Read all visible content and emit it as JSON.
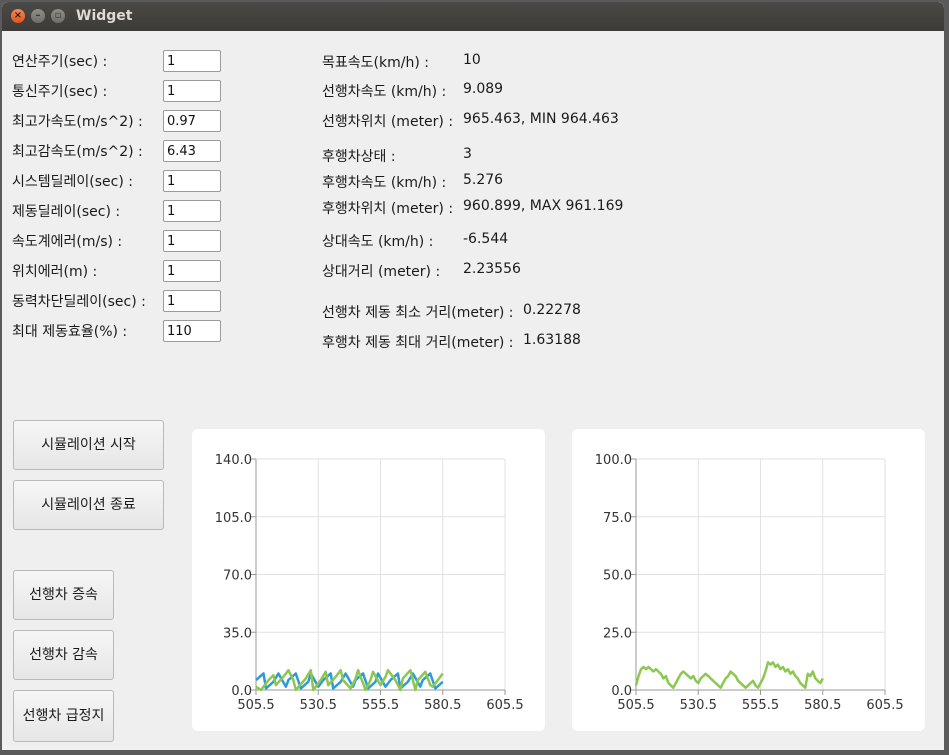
{
  "window": {
    "title": "Widget"
  },
  "params": [
    {
      "label": "연산주기(sec) :",
      "value": "1"
    },
    {
      "label": "통신주기(sec) :",
      "value": "1"
    },
    {
      "label": "최고가속도(m/s^2) :",
      "value": "0.97"
    },
    {
      "label": "최고감속도(m/s^2) :",
      "value": "6.43"
    },
    {
      "label": "시스템딜레이(sec) :",
      "value": "1"
    },
    {
      "label": "제동딜레이(sec) :",
      "value": "1"
    },
    {
      "label": "속도계에러(m/s) :",
      "value": "1"
    },
    {
      "label": "위치에러(m) :",
      "value": "1"
    },
    {
      "label": "동력차단딜레이(sec) :",
      "value": "1"
    },
    {
      "label": "최대 제동효율(%) :",
      "value": "110"
    }
  ],
  "status": [
    {
      "label": "목표속도(km/h) :",
      "value": "10"
    },
    {
      "label": "선행차속도 (km/h) :",
      "value": "9.089"
    },
    {
      "label": "선행차위치 (meter) :",
      "value": "965.463, MIN 964.463"
    },
    {
      "label": "후행차상태 :",
      "value": "3"
    },
    {
      "label": "후행차속도 (km/h) :",
      "value": "5.276"
    },
    {
      "label": "후행차위치 (meter) :",
      "value": "960.899, MAX 961.169"
    },
    {
      "label": "상대속도 (km/h) :",
      "value": "-6.544"
    },
    {
      "label": "상대거리 (meter) :",
      "value": "2.23556"
    },
    {
      "label": "선행차 제동 최소 거리(meter) :",
      "value": "0.22278"
    },
    {
      "label": "후행차 제동 최대 거리(meter) :",
      "value": "1.63188"
    }
  ],
  "buttons": {
    "sim_start": "시뮬레이션 시작",
    "sim_stop": "시뮬레이션 종료",
    "lead_accel": "선행차 증속",
    "lead_decel": "선행차 감속",
    "lead_emergency_stop": "선행차 급정지"
  },
  "colors": {
    "series_blue": "#2f9ad8",
    "series_green": "#8cc84f"
  },
  "chart_data": [
    {
      "type": "line",
      "title": "",
      "xlabel": "",
      "ylabel": "",
      "xlim": [
        505.5,
        605.5
      ],
      "ylim": [
        0,
        140
      ],
      "xticks": [
        "505.5",
        "530.5",
        "555.5",
        "580.5",
        "605.5"
      ],
      "yticks": [
        "140.0",
        "105.0",
        "70.0",
        "35.0",
        "0.0"
      ],
      "grid": true,
      "series": [
        {
          "color": "#2f9ad8",
          "x": [
            505.5,
            508.5,
            509.5,
            512.5,
            514.5,
            517.5,
            518.5,
            521.5,
            523.5,
            526.5,
            527.5,
            530.5,
            532.5,
            535.5,
            536.5,
            539.5,
            541.5,
            544.5,
            545.5,
            548.5,
            550.5,
            553.5,
            554.5,
            557.5,
            559.5,
            562.5,
            563.5,
            566.5,
            568.5,
            571.5,
            572.5,
            575.5,
            577.5,
            580.5
          ],
          "y": [
            6,
            10,
            1,
            5,
            10,
            2,
            6,
            10,
            1,
            5,
            10,
            2,
            6,
            10,
            1,
            5,
            10,
            2,
            6,
            10,
            1,
            5,
            10,
            2,
            6,
            10,
            1,
            5,
            10,
            2,
            6,
            10,
            1,
            5
          ]
        },
        {
          "color": "#8cc84f",
          "x": [
            505.5,
            507.5,
            510.5,
            512.5,
            513.5,
            516.5,
            518.5,
            520.5,
            521.5,
            525.5,
            527.5,
            528.5,
            531.5,
            533.5,
            534.5,
            537.5,
            539.5,
            540.5,
            543.5,
            545.5,
            546.5,
            549.5,
            551.5,
            552.5,
            555.5,
            557.5,
            558.5,
            561.5,
            563.5,
            564.5,
            567.5,
            569.5,
            570.5,
            573.5,
            575.5,
            576.5,
            580.5
          ],
          "y": [
            2,
            0,
            6,
            9,
            3,
            8,
            12,
            6,
            0,
            7,
            12,
            0,
            6,
            11,
            3,
            8,
            12,
            6,
            1,
            7,
            12,
            0,
            6,
            11,
            3,
            8,
            12,
            6,
            0,
            7,
            12,
            0,
            6,
            11,
            3,
            2,
            10
          ]
        }
      ]
    },
    {
      "type": "line",
      "title": "",
      "xlabel": "",
      "ylabel": "",
      "xlim": [
        505.5,
        605.5
      ],
      "ylim": [
        0,
        100
      ],
      "xticks": [
        "505.5",
        "530.5",
        "555.5",
        "580.5",
        "605.5"
      ],
      "yticks": [
        "100.0",
        "75.0",
        "50.0",
        "25.0",
        "0.0"
      ],
      "grid": true,
      "series": [
        {
          "color": "#8cc84f",
          "x": [
            505.5,
            506.5,
            507.5,
            508.5,
            509.5,
            510.5,
            511.5,
            512.5,
            513.5,
            514.5,
            515.5,
            516.5,
            517.5,
            518.5,
            519.5,
            520.5,
            521.5,
            522.5,
            523.5,
            524.5,
            525.5,
            526.5,
            527.5,
            528.5,
            529.5,
            530.5,
            531.5,
            532.5,
            533.5,
            534.5,
            535.5,
            536.5,
            537.5,
            538.5,
            539.5,
            540.5,
            541.5,
            542.5,
            543.5,
            544.5,
            545.5,
            546.5,
            547.5,
            548.5,
            549.5,
            550.5,
            551.5,
            552.5,
            553.5,
            554.5,
            555.5,
            556.5,
            557.5,
            558.5,
            559.5,
            560.5,
            561.5,
            562.5,
            563.5,
            564.5,
            565.5,
            566.5,
            567.5,
            568.5,
            569.5,
            570.5,
            571.5,
            572.5,
            573.5,
            574.5,
            575.5,
            576.5,
            577.5,
            578.5,
            579.5,
            580.5
          ],
          "y": [
            2,
            6,
            9,
            10,
            9,
            10,
            9,
            8,
            9,
            8,
            7,
            5,
            6,
            3,
            2,
            1,
            3,
            5,
            7,
            8,
            7,
            6,
            5,
            6,
            4,
            3,
            5,
            6,
            7,
            6,
            5,
            4,
            3,
            2,
            1,
            3,
            5,
            6,
            8,
            7,
            6,
            4,
            3,
            2,
            1,
            2,
            3,
            4,
            2,
            1,
            3,
            5,
            8,
            12,
            11,
            12,
            10,
            11,
            9,
            10,
            8,
            9,
            7,
            8,
            6,
            5,
            3,
            2,
            1,
            7,
            6,
            8,
            5,
            4,
            3,
            5
          ]
        }
      ]
    }
  ]
}
